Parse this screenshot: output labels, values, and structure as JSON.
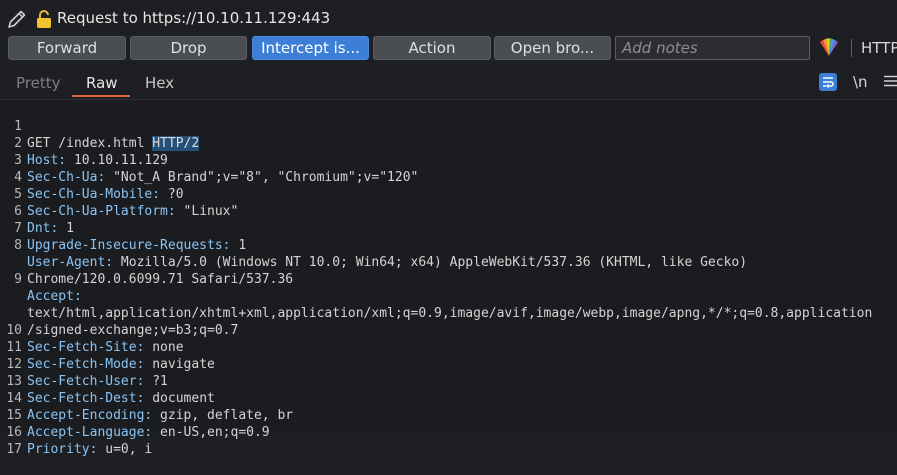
{
  "header": {
    "title": "Request to https://10.10.11.129:443"
  },
  "toolbar": {
    "forward_label": "Forward",
    "drop_label": "Drop",
    "intercept_label": "Intercept is...",
    "action_label": "Action",
    "open_browser_label": "Open bro...",
    "notes_placeholder": "Add notes",
    "http_label": "HTTP"
  },
  "tabs": {
    "pretty": "Pretty",
    "raw": "Raw",
    "hex": "Hex",
    "newline_toggle": "\\n"
  },
  "colors": {
    "accent": "#3d7fd6",
    "tab_underline": "#d9673a",
    "header_name": "#89c4f4"
  },
  "request": {
    "line1_method_path": "GET /index.html ",
    "line1_version": "HTTP/2",
    "headers": [
      {
        "name": "Host:",
        "value": " 10.10.11.129"
      },
      {
        "name": "Sec-Ch-Ua:",
        "value": " \"Not_A Brand\";v=\"8\", \"Chromium\";v=\"120\""
      },
      {
        "name": "Sec-Ch-Ua-Mobile:",
        "value": " ?0"
      },
      {
        "name": "Sec-Ch-Ua-Platform:",
        "value": " \"Linux\""
      },
      {
        "name": "Dnt:",
        "value": " 1"
      },
      {
        "name": "Upgrade-Insecure-Requests:",
        "value": " 1"
      },
      {
        "name": "User-Agent:",
        "value": " Mozilla/5.0 (Windows NT 10.0; Win64; x64) AppleWebKit/537.36 (KHTML, like Gecko)"
      },
      {
        "name": "",
        "value": "Chrome/120.0.6099.71 Safari/537.36"
      },
      {
        "name": "Accept:",
        "value": ""
      },
      {
        "name": "",
        "value": "text/html,application/xhtml+xml,application/xml;q=0.9,image/avif,image/webp,image/apng,*/*;q=0.8,application"
      },
      {
        "name": "",
        "value": "/signed-exchange;v=b3;q=0.7"
      },
      {
        "name": "Sec-Fetch-Site:",
        "value": " none"
      },
      {
        "name": "Sec-Fetch-Mode:",
        "value": " navigate"
      },
      {
        "name": "Sec-Fetch-User:",
        "value": " ?1"
      },
      {
        "name": "Sec-Fetch-Dest:",
        "value": " document"
      },
      {
        "name": "Accept-Encoding:",
        "value": " gzip, deflate, br"
      },
      {
        "name": "Accept-Language:",
        "value": " en-US,en;q=0.9"
      },
      {
        "name": "Priority:",
        "value": " u=0, i"
      },
      {
        "name": "",
        "value": ""
      }
    ],
    "line_numbers": [
      "1",
      "2",
      "3",
      "4",
      "5",
      "6",
      "7",
      "8",
      "",
      "9",
      "",
      "",
      "10",
      "11",
      "12",
      "13",
      "14",
      "15",
      "16",
      "17"
    ]
  }
}
